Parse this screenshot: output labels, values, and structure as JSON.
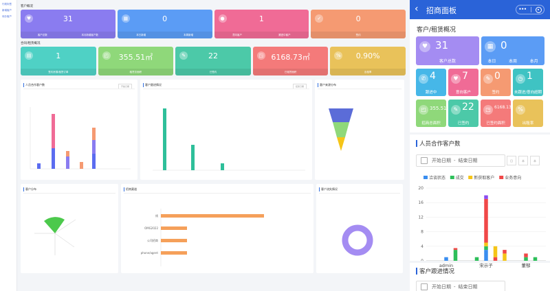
{
  "desktop": {
    "sidebar": [
      "行政标签",
      "新增客户",
      "待办客户"
    ],
    "section1": "客户概况",
    "section2": "合同/租赁概况",
    "row1": [
      {
        "num": "31",
        "foot": [
          "客户总数",
          "本月新增客户数"
        ],
        "color": "#8a7cf0",
        "icon": "heart-hand-icon"
      },
      {
        "num": "0",
        "foot": [
          "本日新增",
          "本周新增"
        ],
        "color": "#5b9cf5",
        "icon": "calendar-icon"
      },
      {
        "num": "1",
        "foot": [
          "意向客户",
          "跟进中客户"
        ],
        "color": "#f06b96",
        "icon": "users-icon"
      },
      {
        "num": "0",
        "foot": [
          "签约"
        ],
        "color": "#f59a72",
        "icon": "check-icon"
      }
    ],
    "row2": [
      {
        "num": "1",
        "foot": [
          "签约房源/租赁订单"
        ],
        "color": "#4fd1c5",
        "icon": "doc-icon"
      },
      {
        "num": "355.51㎡",
        "foot": [
          "租赁总面积"
        ],
        "color": "#8fd87a",
        "icon": "area-icon"
      },
      {
        "num": "22",
        "foot": [
          "已签约"
        ],
        "color": "#4cc9a8",
        "icon": "sign-icon"
      },
      {
        "num": "6168.73㎡",
        "foot": [
          "已租赁面积"
        ],
        "color": "#f47a7a",
        "icon": "area2-icon"
      },
      {
        "num": "0.90%",
        "foot": [
          "出租率"
        ],
        "color": "#e9c25a",
        "icon": "rate-icon"
      }
    ],
    "panels": [
      "人员合作客户数",
      "客户跟进情况",
      "客户来源分布",
      "客户分布",
      "招商渠道",
      "客户流失情况"
    ],
    "date_start": "开始日期",
    "date_end": "结束日期",
    "hbar_labels": [
      "线",
      "OMG2022",
      "公司招商",
      "phone/agent"
    ]
  },
  "phone": {
    "title": "招商面板",
    "section": "客户/租赁概况",
    "big": [
      {
        "num": "31",
        "label": "客户总数",
        "color": "#a48cf2",
        "icon": "handshake-icon"
      },
      {
        "num": "0",
        "labels": [
          "本日",
          "本周",
          "本月"
        ],
        "color": "#5b9cf5",
        "icon": "calendar-icon"
      }
    ],
    "small1": [
      {
        "num": "4",
        "label": "跟进中",
        "color": "#46b7e8",
        "icon": "phone-icon"
      },
      {
        "num": "7",
        "label": "意向客户",
        "color": "#f06b96",
        "icon": "heart-icon"
      },
      {
        "num": "0",
        "label": "签约",
        "color": "#f59a72",
        "icon": "pen-icon"
      },
      {
        "num": "1",
        "label": "未跟进/意向超期",
        "color": "#3fc3c3",
        "icon": "clock-icon"
      }
    ],
    "small2": [
      {
        "num": "355.51",
        "label": "招商总面积",
        "color": "#8fd87a",
        "icon": "area-icon"
      },
      {
        "num": "22",
        "label": "已签约",
        "color": "#4cc9a8",
        "icon": "sign-icon"
      },
      {
        "num": "6168.13",
        "label": "已签约面积",
        "color": "#f47a7a",
        "icon": "area2-icon"
      },
      {
        "num": "",
        "label": "出租率",
        "color": "#e9c25a",
        "icon": "rate-icon"
      }
    ],
    "section2": "人员合作客户数",
    "date_start": "开始日期",
    "date_sep": "-",
    "date_end": "结束日期",
    "range_btns": [
      "日",
      "本",
      "本"
    ],
    "section3": "客户跟进情况",
    "date2_start": "开始日期",
    "date2_end": "结束日期"
  },
  "chart_data": {
    "type": "bar",
    "stacked": true,
    "categories": [
      "admin",
      "宋示子",
      "董郁"
    ],
    "series": [
      {
        "name": "洽谈状态",
        "color": "#3a8ef0",
        "values": [
          1,
          3,
          0
        ]
      },
      {
        "name": "成交",
        "color": "#2ebf5a",
        "values": [
          0,
          1,
          1
        ]
      },
      {
        "name": "新获取客户",
        "color": "#f5c518",
        "values": [
          0,
          1,
          0
        ]
      },
      {
        "name": "业务意向",
        "color": "#f04848",
        "values": [
          0,
          12,
          1
        ]
      },
      {
        "name": "",
        "color": "#8a4cf0",
        "values": [
          0,
          1,
          0
        ]
      }
    ],
    "extra_bars": [
      {
        "category": "admin",
        "offset": 1,
        "segments": [
          {
            "color": "#2ebf5a",
            "value": 3
          },
          {
            "color": "#f04848",
            "value": 0.5
          }
        ]
      },
      {
        "category": "宋示子",
        "offset": -1,
        "segments": [
          {
            "color": "#2ebf5a",
            "value": 1
          }
        ]
      },
      {
        "category": "宋示子",
        "offset": 1,
        "segments": [
          {
            "color": "#f04848",
            "value": 1
          },
          {
            "color": "#f5c518",
            "value": 3
          }
        ]
      },
      {
        "category": "宋示子",
        "offset": 2,
        "segments": [
          {
            "color": "#f5c518",
            "value": 2
          },
          {
            "color": "#f04848",
            "value": 1
          }
        ]
      },
      {
        "category": "董郁",
        "offset": 1,
        "segments": [
          {
            "color": "#2ebf5a",
            "value": 1
          }
        ]
      }
    ],
    "ylim": [
      0,
      20
    ],
    "yticks": [
      0,
      4,
      8,
      12,
      16,
      20
    ]
  }
}
